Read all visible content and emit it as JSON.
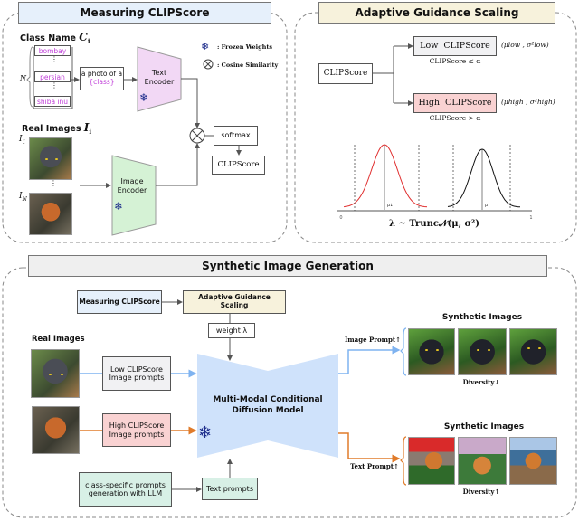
{
  "measuring": {
    "title": "Measuring CLIPScore",
    "class_name_label": "Class Name",
    "class_name_symbol": "C",
    "class_name_sub": "i",
    "classes": [
      "bombay",
      "persian",
      "shiba inu"
    ],
    "n_label": "N",
    "prompt_line1": "a photo of a",
    "prompt_line2": "{class}",
    "text_encoder_line1": "Text",
    "text_encoder_line2": "Encoder",
    "legend_frozen": ": Frozen Weights",
    "legend_cosine": ": Cosine Similarity",
    "real_images_label": "Real Images",
    "real_images_symbol": "I",
    "real_images_sub": "i",
    "i1": "I",
    "i1_sub": "1",
    "in": "I",
    "in_sub": "N",
    "image_encoder_line1": "Image",
    "image_encoder_line2": "Encoder",
    "softmax": "softmax",
    "clipscore": "CLIPScore"
  },
  "adaptive": {
    "title": "Adaptive Guidance Scaling",
    "clipscore": "CLIPScore",
    "low": "Low  CLIPScore",
    "high": "High  CLIPScore",
    "low_params": "(μlow , σ²low)",
    "high_params": "(μhigh , σ²high)",
    "low_cond": "CLIPScore ≤ α",
    "high_cond": "CLIPScore > α",
    "axis_start": "0",
    "axis_end": "1",
    "mu_down": "μ↓",
    "mu_up": "μ↑",
    "formula": "λ ~ Trunc𝒩(μ, σ²)"
  },
  "synthetic": {
    "title": "Synthetic Image Generation",
    "measuring": "Measuring CLIPScore",
    "adaptive": "Adaptive Guidance Scaling",
    "weight": "weight λ",
    "real_images": "Real Images",
    "low_line1": "Low CLIPScore",
    "low_line2": "Image prompts",
    "high_line1": "High CLIPScore",
    "high_line2": "Image prompts",
    "model_line1": "Multi-Modal Conditional",
    "model_line2": "Diffusion Model",
    "llm_line1": "class-specific prompts",
    "llm_line2": "generation with LLM",
    "text_prompts": "Text prompts",
    "image_prompt": "Image Prompt↑",
    "text_prompt": "Text Prompt↑",
    "synthetic_images_1": "Synthetic Images",
    "synthetic_images_2": "Synthetic Images",
    "diversity_down": "Diversity↓",
    "diversity_up": "Diversity↑"
  },
  "colors": {
    "measuring_bg": "#e6f0fb",
    "adaptive_bg": "#f7f2dc",
    "synthetic_bg": "#efefef",
    "text_encoder": "#f2d8f5",
    "image_encoder": "#d5f2d5",
    "diffusion": "#cfe2fb",
    "low_box": "#f1f1f3",
    "high_box": "#f9d2d2",
    "llm_box": "#d8f0e6",
    "image_path": "#7fb3f0",
    "text_path": "#e07b2a",
    "class_text": "#c03fd8"
  }
}
